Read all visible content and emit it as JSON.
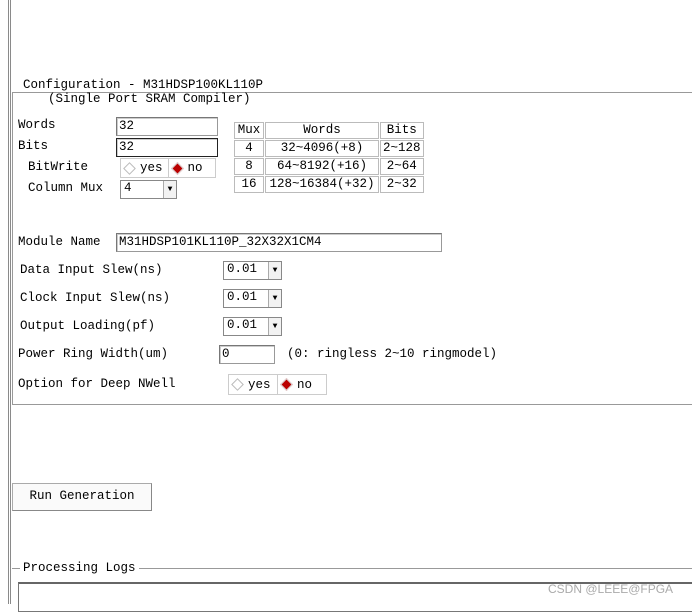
{
  "config": {
    "title": "Configuration - M31HDSP100KL110P",
    "subtitle": "(Single Port SRAM Compiler)",
    "words_label": "Words",
    "words_value": "32",
    "bits_label": "Bits",
    "bits_value": "32",
    "bitwrite_label": "BitWrite",
    "bitwrite_options": [
      "yes",
      "no"
    ],
    "bitwrite_selected": "no",
    "column_mux_label": "Column Mux",
    "column_mux_value": "4",
    "table": {
      "headers": [
        "Mux",
        "Words",
        "Bits"
      ],
      "rows": [
        [
          "4",
          "32~4096(+8)",
          "2~128"
        ],
        [
          "8",
          "64~8192(+16)",
          "2~64"
        ],
        [
          "16",
          "128~16384(+32)",
          "2~32"
        ]
      ]
    },
    "module_name_label": "Module Name",
    "module_name_value": "M31HDSP101KL110P_32X32X1CM4",
    "data_slew_label": "Data Input Slew(ns)",
    "data_slew_value": "0.01",
    "clock_slew_label": "Clock Input Slew(ns)",
    "clock_slew_value": "0.01",
    "output_loading_label": "Output Loading(pf)",
    "output_loading_value": "0.01",
    "power_ring_label": "Power Ring Width(um)",
    "power_ring_value": "0",
    "power_ring_hint": "(0: ringless 2~10 ringmodel)",
    "deep_nwell_label": "Option for Deep NWell",
    "deep_nwell_options": [
      "yes",
      "no"
    ],
    "deep_nwell_selected": "no"
  },
  "run_button": "Run Generation",
  "logs": {
    "title": "Processing Logs"
  },
  "watermark": "CSDN @LEEE@FPGA",
  "colors": {
    "selected_radio": "#bb0000"
  }
}
